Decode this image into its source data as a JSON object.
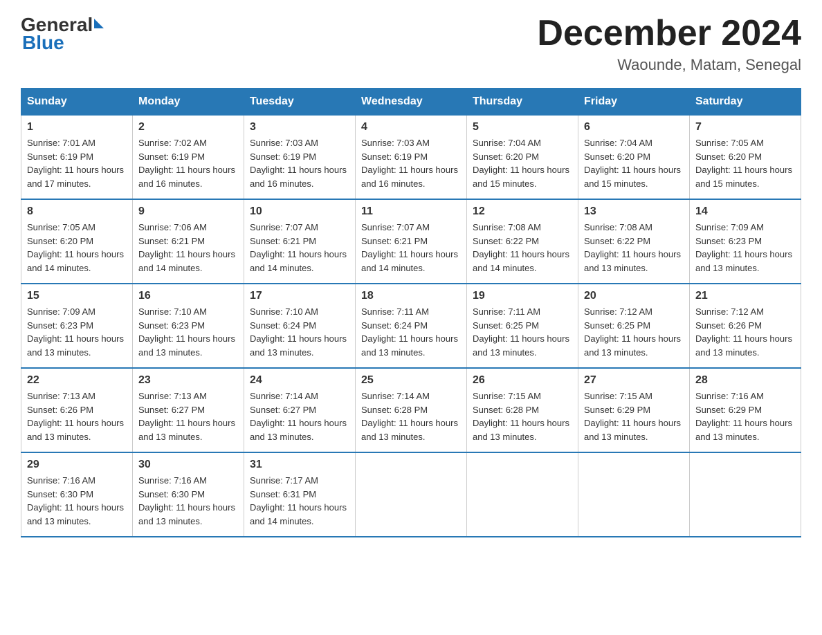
{
  "logo": {
    "general_text": "General",
    "blue_text": "Blue"
  },
  "title": {
    "month_year": "December 2024",
    "location": "Waounde, Matam, Senegal"
  },
  "headers": [
    "Sunday",
    "Monday",
    "Tuesday",
    "Wednesday",
    "Thursday",
    "Friday",
    "Saturday"
  ],
  "weeks": [
    [
      {
        "day": "1",
        "sunrise": "7:01 AM",
        "sunset": "6:19 PM",
        "daylight": "11 hours and 17 minutes."
      },
      {
        "day": "2",
        "sunrise": "7:02 AM",
        "sunset": "6:19 PM",
        "daylight": "11 hours and 16 minutes."
      },
      {
        "day": "3",
        "sunrise": "7:03 AM",
        "sunset": "6:19 PM",
        "daylight": "11 hours and 16 minutes."
      },
      {
        "day": "4",
        "sunrise": "7:03 AM",
        "sunset": "6:19 PM",
        "daylight": "11 hours and 16 minutes."
      },
      {
        "day": "5",
        "sunrise": "7:04 AM",
        "sunset": "6:20 PM",
        "daylight": "11 hours and 15 minutes."
      },
      {
        "day": "6",
        "sunrise": "7:04 AM",
        "sunset": "6:20 PM",
        "daylight": "11 hours and 15 minutes."
      },
      {
        "day": "7",
        "sunrise": "7:05 AM",
        "sunset": "6:20 PM",
        "daylight": "11 hours and 15 minutes."
      }
    ],
    [
      {
        "day": "8",
        "sunrise": "7:05 AM",
        "sunset": "6:20 PM",
        "daylight": "11 hours and 14 minutes."
      },
      {
        "day": "9",
        "sunrise": "7:06 AM",
        "sunset": "6:21 PM",
        "daylight": "11 hours and 14 minutes."
      },
      {
        "day": "10",
        "sunrise": "7:07 AM",
        "sunset": "6:21 PM",
        "daylight": "11 hours and 14 minutes."
      },
      {
        "day": "11",
        "sunrise": "7:07 AM",
        "sunset": "6:21 PM",
        "daylight": "11 hours and 14 minutes."
      },
      {
        "day": "12",
        "sunrise": "7:08 AM",
        "sunset": "6:22 PM",
        "daylight": "11 hours and 14 minutes."
      },
      {
        "day": "13",
        "sunrise": "7:08 AM",
        "sunset": "6:22 PM",
        "daylight": "11 hours and 13 minutes."
      },
      {
        "day": "14",
        "sunrise": "7:09 AM",
        "sunset": "6:23 PM",
        "daylight": "11 hours and 13 minutes."
      }
    ],
    [
      {
        "day": "15",
        "sunrise": "7:09 AM",
        "sunset": "6:23 PM",
        "daylight": "11 hours and 13 minutes."
      },
      {
        "day": "16",
        "sunrise": "7:10 AM",
        "sunset": "6:23 PM",
        "daylight": "11 hours and 13 minutes."
      },
      {
        "day": "17",
        "sunrise": "7:10 AM",
        "sunset": "6:24 PM",
        "daylight": "11 hours and 13 minutes."
      },
      {
        "day": "18",
        "sunrise": "7:11 AM",
        "sunset": "6:24 PM",
        "daylight": "11 hours and 13 minutes."
      },
      {
        "day": "19",
        "sunrise": "7:11 AM",
        "sunset": "6:25 PM",
        "daylight": "11 hours and 13 minutes."
      },
      {
        "day": "20",
        "sunrise": "7:12 AM",
        "sunset": "6:25 PM",
        "daylight": "11 hours and 13 minutes."
      },
      {
        "day": "21",
        "sunrise": "7:12 AM",
        "sunset": "6:26 PM",
        "daylight": "11 hours and 13 minutes."
      }
    ],
    [
      {
        "day": "22",
        "sunrise": "7:13 AM",
        "sunset": "6:26 PM",
        "daylight": "11 hours and 13 minutes."
      },
      {
        "day": "23",
        "sunrise": "7:13 AM",
        "sunset": "6:27 PM",
        "daylight": "11 hours and 13 minutes."
      },
      {
        "day": "24",
        "sunrise": "7:14 AM",
        "sunset": "6:27 PM",
        "daylight": "11 hours and 13 minutes."
      },
      {
        "day": "25",
        "sunrise": "7:14 AM",
        "sunset": "6:28 PM",
        "daylight": "11 hours and 13 minutes."
      },
      {
        "day": "26",
        "sunrise": "7:15 AM",
        "sunset": "6:28 PM",
        "daylight": "11 hours and 13 minutes."
      },
      {
        "day": "27",
        "sunrise": "7:15 AM",
        "sunset": "6:29 PM",
        "daylight": "11 hours and 13 minutes."
      },
      {
        "day": "28",
        "sunrise": "7:16 AM",
        "sunset": "6:29 PM",
        "daylight": "11 hours and 13 minutes."
      }
    ],
    [
      {
        "day": "29",
        "sunrise": "7:16 AM",
        "sunset": "6:30 PM",
        "daylight": "11 hours and 13 minutes."
      },
      {
        "day": "30",
        "sunrise": "7:16 AM",
        "sunset": "6:30 PM",
        "daylight": "11 hours and 13 minutes."
      },
      {
        "day": "31",
        "sunrise": "7:17 AM",
        "sunset": "6:31 PM",
        "daylight": "11 hours and 14 minutes."
      },
      null,
      null,
      null,
      null
    ]
  ],
  "labels": {
    "sunrise": "Sunrise:",
    "sunset": "Sunset:",
    "daylight": "Daylight:"
  }
}
